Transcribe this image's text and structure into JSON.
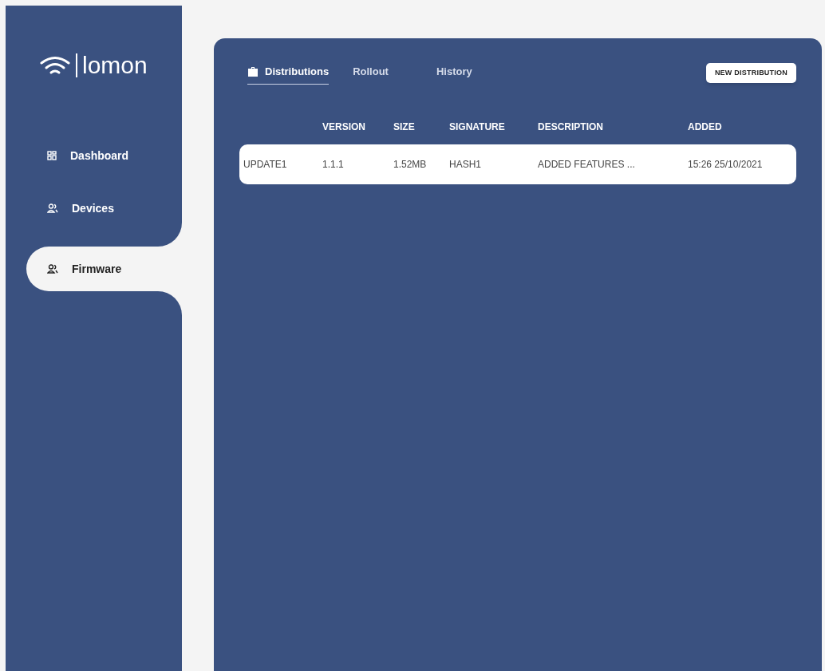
{
  "sidebar": {
    "logo": "lomon",
    "items": [
      {
        "label": "Dashboard",
        "selected": false
      },
      {
        "label": "Devices",
        "selected": false
      },
      {
        "label": "Firmware",
        "selected": true
      }
    ]
  },
  "tabs": [
    {
      "label": "Distributions",
      "selected": true
    },
    {
      "label": "Rollout",
      "selected": false
    },
    {
      "label": "History",
      "selected": false
    }
  ],
  "new_button": "NEW DISTRIBUTION",
  "table": {
    "columns": [
      "",
      "VERSION",
      "SIZE",
      "SIGNATURE",
      "DESCRIPTION",
      "ADDED"
    ],
    "rows": [
      [
        "UPDATE1",
        "1.1.1",
        "1.52MB",
        "HASH1",
        "ADDED FEATURES ...",
        "15:26 25/10/2021"
      ]
    ]
  }
}
